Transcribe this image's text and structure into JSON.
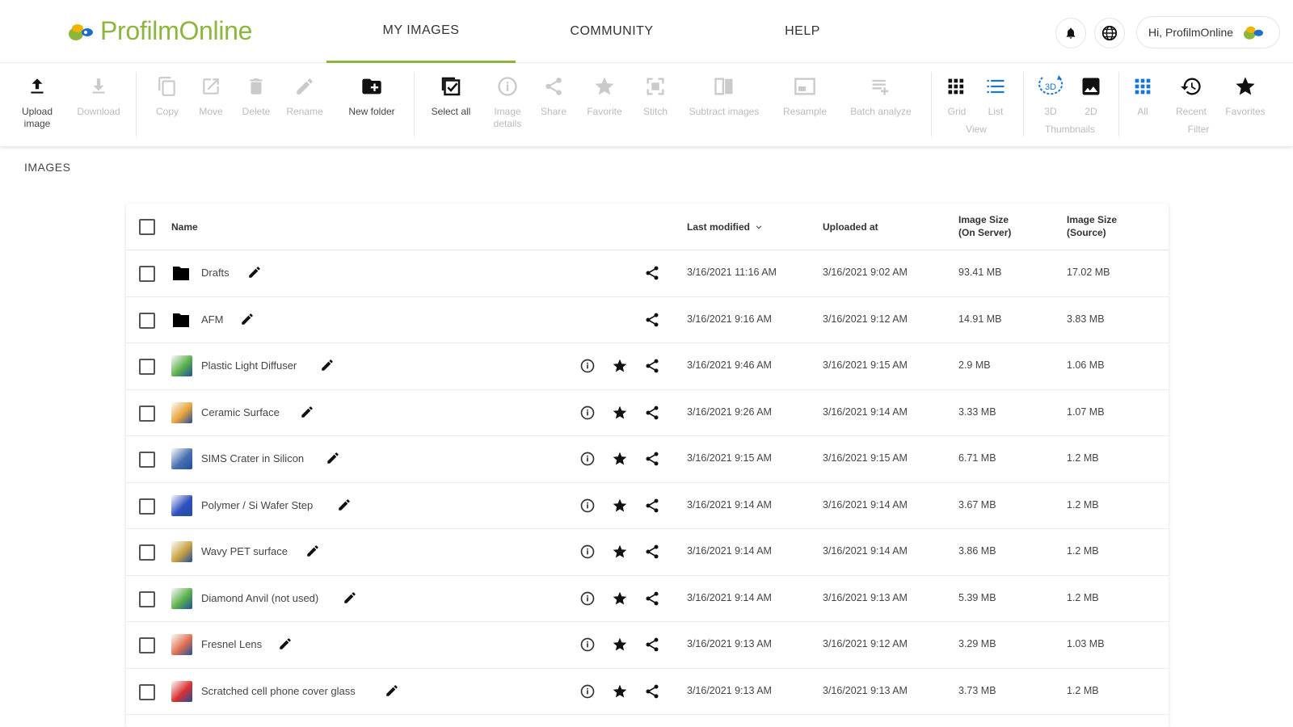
{
  "app": {
    "brand_name": "ProfilmOnline",
    "accent": "#8cb63c"
  },
  "nav": {
    "tabs": [
      {
        "label": "MY IMAGES",
        "active": true
      },
      {
        "label": "COMMUNITY",
        "active": false
      },
      {
        "label": "HELP",
        "active": false
      }
    ],
    "bell_icon": "bell-icon",
    "language_icon": "globe-icon",
    "user_greeting": "Hi, ProfilmOnline"
  },
  "toolbar": {
    "upload": "Upload image",
    "download": "Download",
    "copy": "Copy",
    "move": "Move",
    "delete": "Delete",
    "rename": "Rename",
    "new_folder": "New folder",
    "select_all": "Select all",
    "image_details": "Image details",
    "share": "Share",
    "favorite": "Favorite",
    "stitch": "Stitch",
    "subtract_images": "Subtract images",
    "resample": "Resample",
    "batch_analyze": "Batch analyze",
    "view_grid": "Grid",
    "view_list": "List",
    "view_group": "View",
    "thumb_3d": "3D",
    "thumb_2d": "2D",
    "thumbnails_group": "Thumbnails",
    "filter_all": "All",
    "filter_recent": "Recent",
    "filter_favorites": "Favorites",
    "filter_group": "Filter",
    "blue": "#1976d2"
  },
  "page": {
    "section_title": "IMAGES"
  },
  "table": {
    "headers": {
      "name": "Name",
      "last_modified": "Last modified",
      "uploaded_at": "Uploaded at",
      "size_server_1": "Image Size",
      "size_server_2": "(On Server)",
      "size_source_1": "Image Size",
      "size_source_2": "(Source)"
    },
    "sort_icon": "chevron-down-icon",
    "rows": [
      {
        "type": "folder",
        "name": "Drafts",
        "modified": "3/16/2021 11:16 AM",
        "uploaded": "3/16/2021 9:02 AM",
        "server": "93.41 MB",
        "source": "17.02 MB",
        "thumb_color": "#000000"
      },
      {
        "type": "folder",
        "name": "AFM",
        "modified": "3/16/2021 9:16 AM",
        "uploaded": "3/16/2021 9:12 AM",
        "server": "14.91 MB",
        "source": "3.83 MB",
        "thumb_color": "#000000"
      },
      {
        "type": "image",
        "name": "Plastic Light Diffuser",
        "modified": "3/16/2021 9:46 AM",
        "uploaded": "3/16/2021 9:15 AM",
        "server": "2.9 MB",
        "source": "1.06 MB",
        "thumb_color": "#5ab04a"
      },
      {
        "type": "image",
        "name": "Ceramic Surface",
        "modified": "3/16/2021 9:26 AM",
        "uploaded": "3/16/2021 9:14 AM",
        "server": "3.33 MB",
        "source": "1.07 MB",
        "thumb_color": "#e8a23a"
      },
      {
        "type": "image",
        "name": "SIMS Crater in Silicon",
        "modified": "3/16/2021 9:15 AM",
        "uploaded": "3/16/2021 9:15 AM",
        "server": "6.71 MB",
        "source": "1.2 MB",
        "thumb_color": "#4a6fb0"
      },
      {
        "type": "image",
        "name": "Polymer / Si Wafer Step",
        "modified": "3/16/2021 9:14 AM",
        "uploaded": "3/16/2021 9:14 AM",
        "server": "3.67 MB",
        "source": "1.2 MB",
        "thumb_color": "#3050c0"
      },
      {
        "type": "image",
        "name": "Wavy PET surface",
        "modified": "3/16/2021 9:14 AM",
        "uploaded": "3/16/2021 9:14 AM",
        "server": "3.86 MB",
        "source": "1.2 MB",
        "thumb_color": "#c8a040"
      },
      {
        "type": "image",
        "name": "Diamond Anvil (not used)",
        "modified": "3/16/2021 9:14 AM",
        "uploaded": "3/16/2021 9:13 AM",
        "server": "5.39 MB",
        "source": "1.2 MB",
        "thumb_color": "#5ab04a"
      },
      {
        "type": "image",
        "name": "Fresnel Lens",
        "modified": "3/16/2021 9:13 AM",
        "uploaded": "3/16/2021 9:12 AM",
        "server": "3.29 MB",
        "source": "1.03 MB",
        "thumb_color": "#e07050"
      },
      {
        "type": "image",
        "name": "Scratched cell phone cover glass",
        "modified": "3/16/2021 9:13 AM",
        "uploaded": "3/16/2021 9:13 AM",
        "server": "3.73 MB",
        "source": "1.2 MB",
        "thumb_color": "#d83030"
      }
    ]
  }
}
